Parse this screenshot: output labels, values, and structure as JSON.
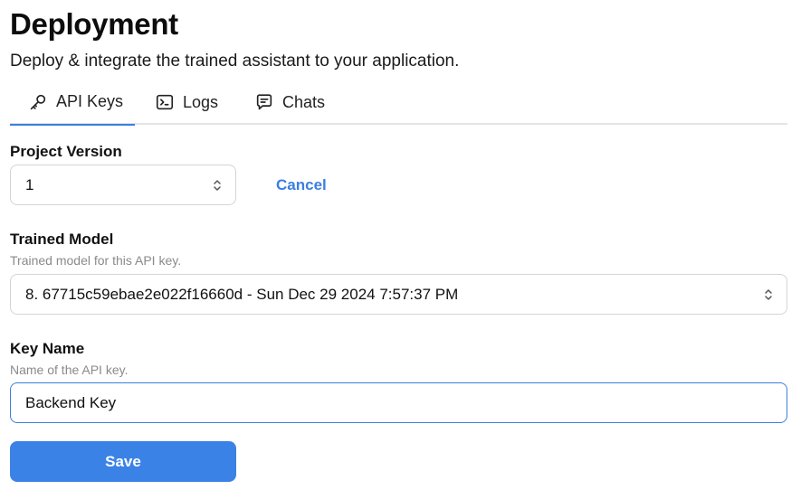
{
  "header": {
    "title": "Deployment",
    "subtitle": "Deploy & integrate the trained assistant to your application."
  },
  "tabs": [
    {
      "label": "API Keys",
      "icon": "key-icon",
      "active": true
    },
    {
      "label": "Logs",
      "icon": "terminal-icon",
      "active": false
    },
    {
      "label": "Chats",
      "icon": "chat-icon",
      "active": false
    }
  ],
  "form": {
    "project_version": {
      "label": "Project Version",
      "value": "1"
    },
    "cancel_label": "Cancel",
    "trained_model": {
      "label": "Trained Model",
      "help": "Trained model for this API key.",
      "value": "8. 67715c59ebae2e022f16660d - Sun Dec 29 2024 7:57:37 PM"
    },
    "key_name": {
      "label": "Key Name",
      "help": "Name of the API key.",
      "value": "Backend Key"
    },
    "save_label": "Save"
  },
  "colors": {
    "accent": "#3b82e6",
    "link": "#3b7fe0",
    "border": "#d4d4d4",
    "help_text": "#8a8a8a"
  }
}
